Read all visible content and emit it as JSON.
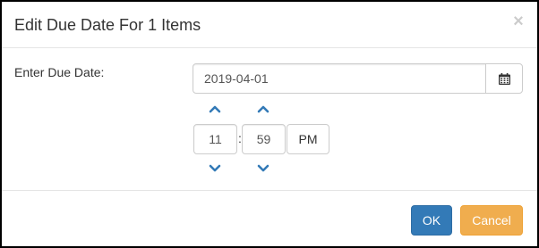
{
  "dialog": {
    "title": "Edit Due Date For 1 Items",
    "close_label": "×"
  },
  "form": {
    "due_date_label": "Enter Due Date:",
    "due_date_value": "2019-04-01"
  },
  "time": {
    "hour": "11",
    "minute": "59",
    "separator": ":",
    "meridian": "PM"
  },
  "footer": {
    "ok_label": "OK",
    "cancel_label": "Cancel"
  },
  "colors": {
    "primary": "#337ab7",
    "warning": "#f0ad4e",
    "chevron": "#337ab7"
  },
  "icons": {
    "calendar": "calendar-icon",
    "up": "chevron-up-icon",
    "down": "chevron-down-icon"
  }
}
